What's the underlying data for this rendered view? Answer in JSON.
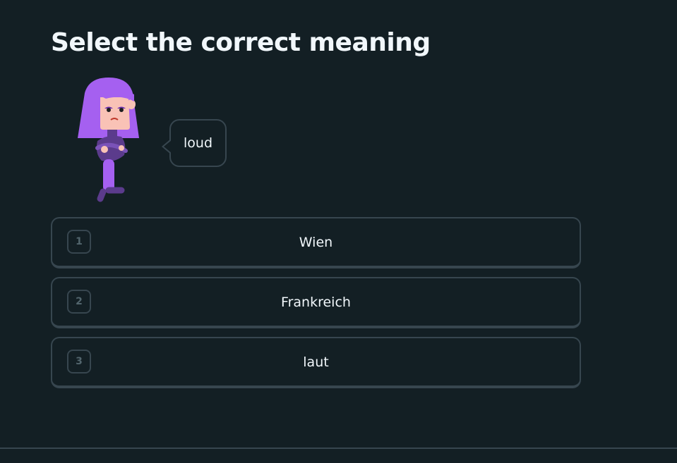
{
  "challenge": {
    "title": "Select the correct meaning"
  },
  "bubble": {
    "text": "loud"
  },
  "options": [
    {
      "number": "1",
      "label": "Wien"
    },
    {
      "number": "2",
      "label": "Frankreich"
    },
    {
      "number": "3",
      "label": "laut"
    }
  ],
  "colors": {
    "background": "#131f24",
    "border": "#37464f",
    "text": "#f1f7fb",
    "character_hair": "#a560f0",
    "character_skin": "#f9c2b6",
    "character_body": "#5b3b8c"
  },
  "icons": {
    "character": "lily-character-illustration"
  }
}
